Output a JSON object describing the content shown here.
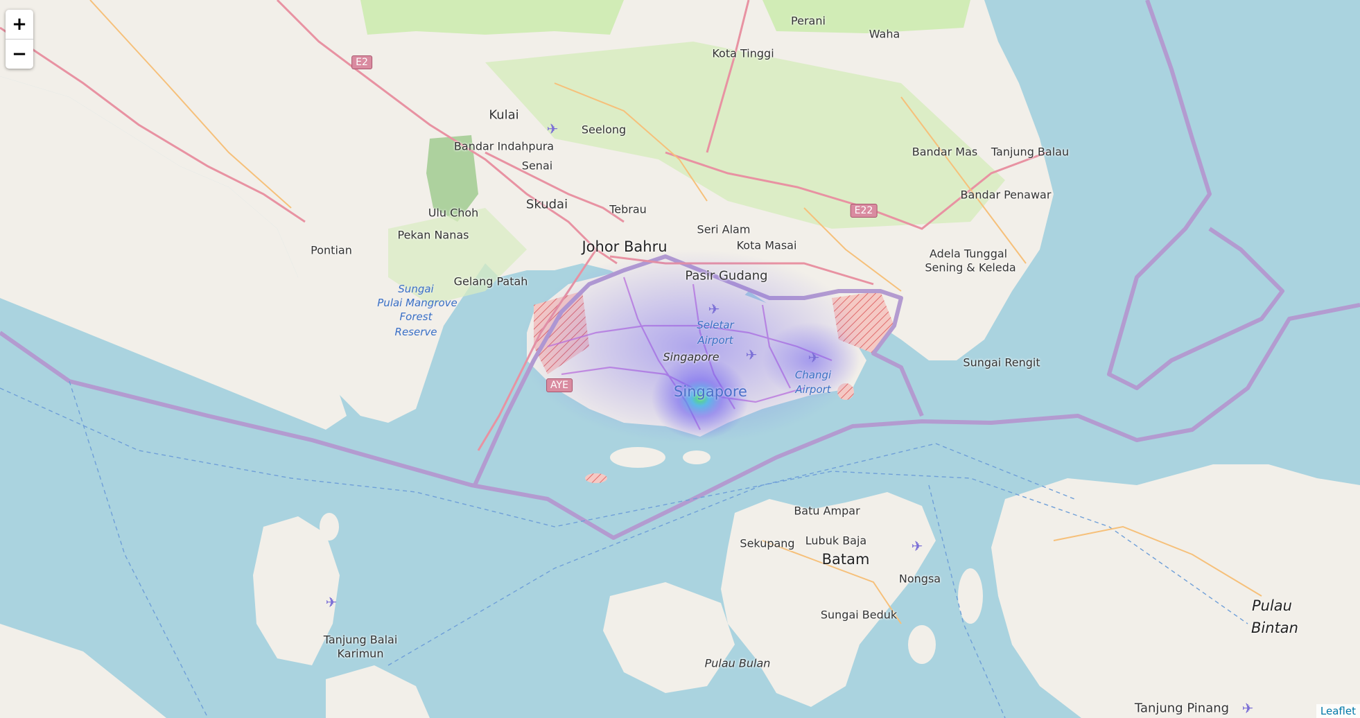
{
  "map": {
    "controls": {
      "zoom_in": "+",
      "zoom_out": "−"
    },
    "attribution": "Leaflet",
    "colors": {
      "sea": "#aad3df",
      "land": "#f2efe9",
      "forest": "#cdebb0",
      "boundary": "#b39bd0",
      "road": "#e892a2",
      "heat_low": "#6b5cf0",
      "heat_high": "#4ee05a"
    },
    "labels": [
      {
        "text": "Perani",
        "style": "normal"
      },
      {
        "text": "Waha",
        "style": "normal"
      },
      {
        "text": "Kota Tinggi",
        "style": "normal"
      },
      {
        "text": "Kulai",
        "style": "med"
      },
      {
        "text": "Seelong",
        "style": "normal"
      },
      {
        "text": "Bandar Indahpura",
        "style": "normal"
      },
      {
        "text": "Senai",
        "style": "normal"
      },
      {
        "text": "Skudai",
        "style": "med"
      },
      {
        "text": "Tebrau",
        "style": "normal"
      },
      {
        "text": "Ulu Choh",
        "style": "normal"
      },
      {
        "text": "Pekan Nanas",
        "style": "normal"
      },
      {
        "text": "Pontian",
        "style": "normal"
      },
      {
        "text": "Johor Bahru",
        "style": "big"
      },
      {
        "text": "Seri Alam",
        "style": "normal"
      },
      {
        "text": "Kota Masai",
        "style": "normal"
      },
      {
        "text": "Bandar Mas",
        "style": "normal"
      },
      {
        "text": "Tanjung Balau",
        "style": "normal"
      },
      {
        "text": "Bandar Penawar",
        "style": "normal"
      },
      {
        "text": "Adela Tunggal",
        "style": "normal"
      },
      {
        "text": "Sening & Keleda",
        "style": "normal"
      },
      {
        "text": "Pasir Gudang",
        "style": "med"
      },
      {
        "text": "Gelang Patah",
        "style": "normal"
      },
      {
        "text": "Singapore",
        "style": "ital"
      },
      {
        "text": "Singapore",
        "style": "bigblue"
      },
      {
        "text": "Sungai Rengit",
        "style": "normal"
      },
      {
        "text": "Batu Ampar",
        "style": "normal"
      },
      {
        "text": "Sekupang",
        "style": "normal"
      },
      {
        "text": "Lubuk Baja",
        "style": "normal"
      },
      {
        "text": "Batam",
        "style": "big"
      },
      {
        "text": "Nongsa",
        "style": "normal"
      },
      {
        "text": "Sungai Beduk",
        "style": "normal"
      },
      {
        "text": "Tanjung Balai",
        "style": "normal"
      },
      {
        "text": "Karimun",
        "style": "normal"
      },
      {
        "text": "Pulau Bulan",
        "style": "ital"
      },
      {
        "text": "Pulau",
        "style": "bigital"
      },
      {
        "text": "Bintan",
        "style": "bigital"
      },
      {
        "text": "Tanjung Pinang",
        "style": "med"
      }
    ],
    "water_labels": [
      "Sungai",
      "Pulai Mangrove",
      "Forest",
      "Reserve",
      "Seletar",
      "Airport",
      "Changi",
      "Airport"
    ],
    "road_shields": [
      "E2",
      "E22",
      "AYE"
    ],
    "airports": [
      "plane-icon",
      "plane-icon",
      "plane-icon",
      "plane-icon",
      "plane-icon",
      "plane-icon"
    ]
  }
}
